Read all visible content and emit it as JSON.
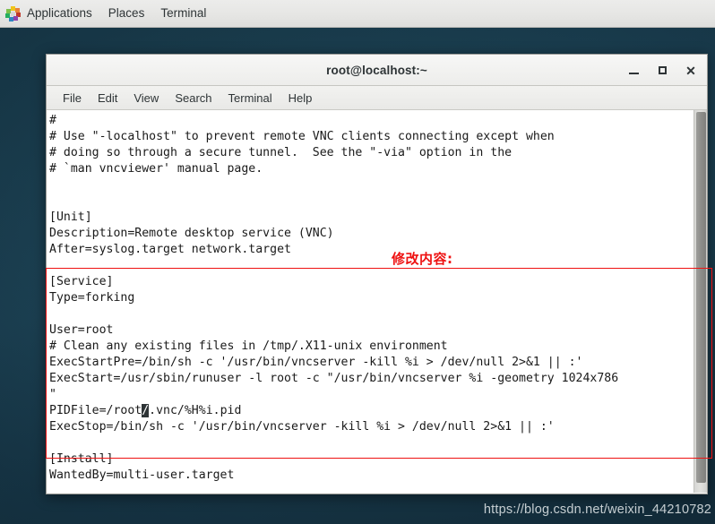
{
  "panel": {
    "apps_icon": "applications-pinwheel-icon",
    "items": [
      {
        "label": "Applications"
      },
      {
        "label": "Places"
      },
      {
        "label": "Terminal"
      }
    ]
  },
  "window": {
    "title": "root@localhost:~",
    "buttons": {
      "minimize": "minimize-icon",
      "maximize": "maximize-icon",
      "close": "close-icon"
    }
  },
  "menubar": {
    "items": [
      {
        "label": "File"
      },
      {
        "label": "Edit"
      },
      {
        "label": "View"
      },
      {
        "label": "Search"
      },
      {
        "label": "Terminal"
      },
      {
        "label": "Help"
      }
    ]
  },
  "terminal": {
    "lines": [
      "#",
      "# Use \"-localhost\" to prevent remote VNC clients connecting except when",
      "# doing so through a secure tunnel.  See the \"-via\" option in the",
      "# `man vncviewer' manual page.",
      "",
      "",
      "[Unit]",
      "Description=Remote desktop service (VNC)",
      "After=syslog.target network.target",
      "",
      "[Service]",
      "Type=forking",
      "",
      "User=root",
      "# Clean any existing files in /tmp/.X11-unix environment",
      "ExecStartPre=/bin/sh -c '/usr/bin/vncserver -kill %i > /dev/null 2>&1 || :'",
      "ExecStart=/usr/sbin/runuser -l root -c \"/usr/bin/vncserver %i -geometry 1024x786",
      "\"",
      "PIDFile=/root/.vnc/%H%i.pid",
      "ExecStop=/bin/sh -c '/usr/bin/vncserver -kill %i > /dev/null 2>&1 || :'",
      "",
      "[Install]",
      "WantedBy=multi-user.target"
    ],
    "cursor": {
      "line_index": 18,
      "column_index": 13,
      "char": "/"
    },
    "pid_line_before": "PIDFile=/root",
    "pid_line_after": ".vnc/%H%i.pid"
  },
  "annotation": {
    "label": "修改内容:",
    "color": "#ee1111"
  },
  "watermark": {
    "text": "https://blog.csdn.net/weixin_44210782"
  },
  "colors": {
    "panel_bg": "#e8e8e6",
    "desktop_bg": "#1c4153",
    "terminal_bg": "#ffffff",
    "terminal_fg": "#1a1a1a",
    "accent_red": "#ee1111"
  }
}
